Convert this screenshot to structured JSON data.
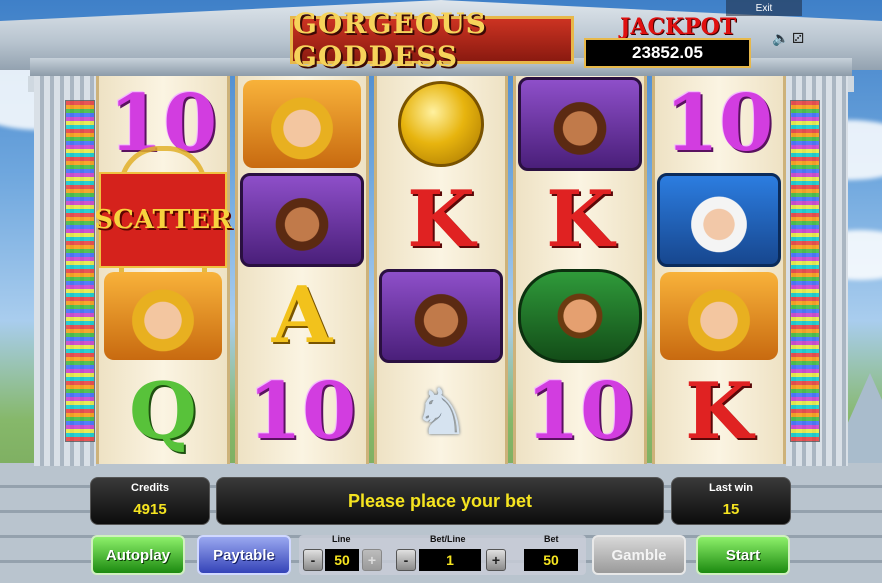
{
  "game": {
    "title": "GORGEOUS GODDESS",
    "jackpot_label": "JACKPOT",
    "jackpot_value": "23852.05",
    "exit_label": "Exit",
    "sound_icon": "speaker-icon",
    "settings_icon": "dice-icon"
  },
  "reels": [
    [
      "10",
      "scatter",
      "goddess",
      "Q"
    ],
    [
      "goddess",
      "warrior",
      "A",
      "10"
    ],
    [
      "coin",
      "K",
      "warrior",
      "pegasus"
    ],
    [
      "warrior",
      "K",
      "hero",
      "10"
    ],
    [
      "10",
      "zeus",
      "goddess",
      "K"
    ]
  ],
  "scatter_label": "SCATTER",
  "info": {
    "credits_label": "Credits",
    "credits_value": "4915",
    "message": "Please place your bet",
    "last_win_label": "Last win",
    "last_win_value": "15"
  },
  "controls": {
    "autoplay": "Autoplay",
    "paytable": "Paytable",
    "line_label": "Line",
    "line_value": "50",
    "betline_label": "Bet/Line",
    "betline_value": "1",
    "bet_label": "Bet",
    "bet_value": "50",
    "gamble": "Gamble",
    "start": "Start",
    "minus": "-",
    "plus": "+"
  },
  "colors": {
    "accent_yellow": "#f5e420",
    "title_red": "#c32222",
    "start_green": "#1c8a10",
    "paytable_blue": "#3443b8"
  }
}
